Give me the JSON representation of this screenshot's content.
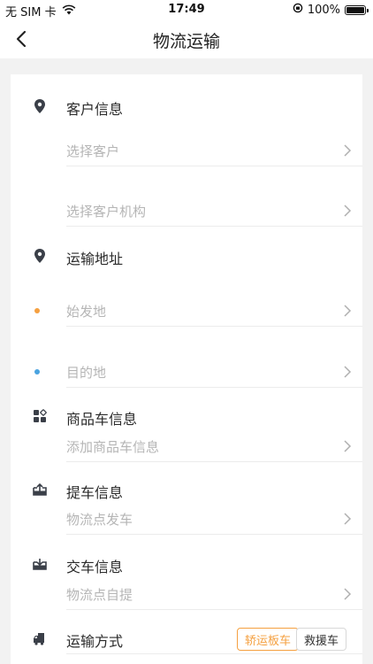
{
  "status_bar": {
    "carrier": "无 SIM 卡",
    "time": "17:49",
    "battery": "100%"
  },
  "nav": {
    "title": "物流运输"
  },
  "customer": {
    "header": "客户信息",
    "select_customer": "选择客户",
    "select_org": "选择客户机构"
  },
  "address": {
    "header": "运输地址",
    "origin": "始发地",
    "destination": "目的地",
    "origin_color": "#f5a040",
    "destination_color": "#4aa3e0"
  },
  "goods": {
    "header": "商品车信息",
    "add": "添加商品车信息"
  },
  "pickup": {
    "header": "提车信息",
    "value": "物流点发车"
  },
  "delivery": {
    "header": "交车信息",
    "value": "物流点自提"
  },
  "transport": {
    "header": "运输方式",
    "options": [
      {
        "label": "轿运板车",
        "selected": true
      },
      {
        "label": "救援车",
        "selected": false
      }
    ],
    "accent": "#f5a040"
  }
}
